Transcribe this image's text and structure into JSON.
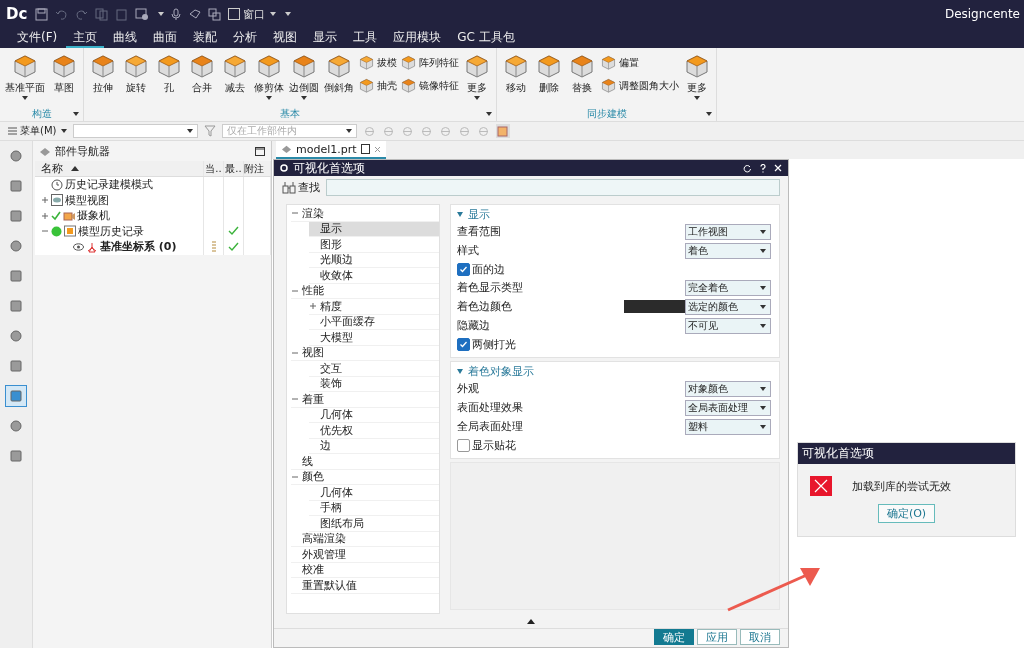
{
  "quick_access": {
    "logo": "Dc",
    "window_menu": "窗口"
  },
  "window": {
    "title": "Designcente"
  },
  "menu": [
    {
      "label": "文件(F)",
      "selected": false
    },
    {
      "label": "主页",
      "selected": true
    },
    {
      "label": "曲线",
      "selected": false
    },
    {
      "label": "曲面",
      "selected": false
    },
    {
      "label": "装配",
      "selected": false
    },
    {
      "label": "分析",
      "selected": false
    },
    {
      "label": "视图",
      "selected": false
    },
    {
      "label": "显示",
      "selected": false
    },
    {
      "label": "工具",
      "selected": false
    },
    {
      "label": "应用模块",
      "selected": false
    },
    {
      "label": "GC 工具包",
      "selected": false
    }
  ],
  "ribbon": [
    {
      "label": "构造",
      "items": [
        {
          "kind": "large",
          "label": "基准平面",
          "caret": true
        },
        {
          "kind": "large",
          "label": "草图",
          "caret": false
        }
      ]
    },
    {
      "label": "基本",
      "items": [
        {
          "kind": "large",
          "label": "拉伸",
          "caret": false
        },
        {
          "kind": "large",
          "label": "旋转",
          "caret": false
        },
        {
          "kind": "large",
          "label": "孔",
          "caret": false
        },
        {
          "kind": "large",
          "label": "合并",
          "caret": false
        },
        {
          "kind": "large",
          "label": "减去",
          "caret": false
        },
        {
          "kind": "large",
          "label": "修剪体",
          "caret": true
        },
        {
          "kind": "large",
          "label": "边倒圆",
          "caret": true
        },
        {
          "kind": "large",
          "label": "倒斜角",
          "caret": false
        },
        {
          "kind": "stack",
          "items": [
            {
              "label": "拔模"
            },
            {
              "label": "抽壳"
            }
          ]
        },
        {
          "kind": "stack",
          "items": [
            {
              "label": "阵列特征"
            },
            {
              "label": "镜像特征"
            }
          ]
        },
        {
          "kind": "large",
          "label": "更多",
          "caret": true
        }
      ]
    },
    {
      "label": "同步建模",
      "items": [
        {
          "kind": "large",
          "label": "移动",
          "caret": false
        },
        {
          "kind": "large",
          "label": "删除",
          "caret": false
        },
        {
          "kind": "large",
          "label": "替换",
          "caret": false
        },
        {
          "kind": "stack",
          "items": [
            {
              "label": "偏置"
            },
            {
              "label": "调整圆角大小"
            }
          ]
        },
        {
          "kind": "large",
          "label": "更多",
          "caret": true
        }
      ]
    }
  ],
  "toolbar": {
    "menu_button": "菜单(M)",
    "scope_filter": "仅在工作部件内"
  },
  "side_strip": [
    {
      "selected": false
    },
    {
      "selected": false
    },
    {
      "selected": false
    },
    {
      "selected": false
    },
    {
      "selected": false
    },
    {
      "selected": false
    },
    {
      "selected": false
    },
    {
      "selected": false
    },
    {
      "selected": true
    },
    {
      "selected": false
    },
    {
      "selected": false
    }
  ],
  "navigator": {
    "title": "部件导航器",
    "columns": [
      "名称",
      "当..",
      "最..",
      "附注"
    ],
    "tree": [
      {
        "label": "历史记录建模模式",
        "kind": "clock",
        "checked": false,
        "active": false,
        "latest": false,
        "current": false
      },
      {
        "label": "模型视图",
        "kind": "view",
        "expanded": false,
        "checked": false,
        "active": false,
        "latest": false,
        "current": false
      },
      {
        "label": "摄象机",
        "kind": "camera",
        "expanded": false,
        "checked": true,
        "active": false,
        "latest": false,
        "current": false
      },
      {
        "label": "模型历史记录",
        "kind": "history",
        "expanded": true,
        "checked": false,
        "active": true,
        "latest": true,
        "current": false,
        "children": [
          {
            "label": "基准坐标系 (0)",
            "kind": "datum",
            "checked": false,
            "active": false,
            "latest": true,
            "current": true
          }
        ]
      }
    ]
  },
  "tabs": [
    {
      "label": "model1.prt",
      "selected": true
    }
  ],
  "dialog": {
    "title": "可视化首选项",
    "search_label": "查找",
    "tree": [
      {
        "label": "渲染",
        "expanded": true,
        "selected": false,
        "children": [
          {
            "label": "显示",
            "selected": true
          },
          {
            "label": "图形",
            "selected": false
          },
          {
            "label": "光顺边",
            "selected": false
          },
          {
            "label": "收敛体",
            "selected": false
          }
        ]
      },
      {
        "label": "性能",
        "expanded": true,
        "selected": false,
        "children": [
          {
            "label": "精度",
            "expanded": false,
            "selected": false
          },
          {
            "label": "小平面缓存",
            "selected": false
          },
          {
            "label": "大模型",
            "selected": false
          }
        ]
      },
      {
        "label": "视图",
        "expanded": true,
        "selected": false,
        "children": [
          {
            "label": "交互",
            "selected": false
          },
          {
            "label": "装饰",
            "selected": false
          }
        ]
      },
      {
        "label": "着重",
        "expanded": true,
        "selected": false,
        "children": [
          {
            "label": "几何体",
            "selected": false
          },
          {
            "label": "优先权",
            "selected": false
          },
          {
            "label": "边",
            "selected": false
          }
        ]
      },
      {
        "label": "线",
        "selected": false
      },
      {
        "label": "颜色",
        "expanded": true,
        "selected": false,
        "children": [
          {
            "label": "几何体",
            "selected": false
          },
          {
            "label": "手柄",
            "selected": false
          },
          {
            "label": "图纸布局",
            "selected": false
          }
        ]
      },
      {
        "label": "高端渲染",
        "selected": false
      },
      {
        "label": "外观管理",
        "selected": false
      },
      {
        "label": "校准",
        "selected": false
      },
      {
        "label": "重置默认值",
        "selected": false
      }
    ],
    "sections": [
      {
        "title": "显示",
        "expanded": true,
        "rows": [
          {
            "kind": "dropdown",
            "label": "查看范围",
            "value": "工作视图"
          },
          {
            "kind": "dropdown",
            "label": "样式",
            "value": "着色"
          },
          {
            "kind": "checkbox",
            "label": "面的边",
            "checked": true
          },
          {
            "kind": "dropdown",
            "label": "着色显示类型",
            "value": "完全着色"
          },
          {
            "kind": "color_dropdown",
            "label": "着色边颜色",
            "value": "选定的颜色",
            "color": "#2b2b2b"
          },
          {
            "kind": "dropdown",
            "label": "隐藏边",
            "value": "不可见"
          },
          {
            "kind": "checkbox",
            "label": "两侧打光",
            "checked": true
          }
        ]
      },
      {
        "title": "着色对象显示",
        "expanded": true,
        "rows": [
          {
            "kind": "dropdown",
            "label": "外观",
            "value": "对象颜色"
          },
          {
            "kind": "dropdown",
            "label": "表面处理效果",
            "value": "全局表面处理"
          },
          {
            "kind": "dropdown",
            "label": "全局表面处理",
            "value": "塑料"
          },
          {
            "kind": "checkbox",
            "label": "显示贴花",
            "checked": false
          }
        ]
      }
    ],
    "buttons": [
      {
        "label": "确定",
        "kind": "primary"
      },
      {
        "label": "应用",
        "kind": "normal"
      },
      {
        "label": "取消",
        "kind": "normal"
      }
    ]
  },
  "message": {
    "title": "可视化首选项",
    "text": "加载到库的尝试无效",
    "button": "确定(O)"
  }
}
